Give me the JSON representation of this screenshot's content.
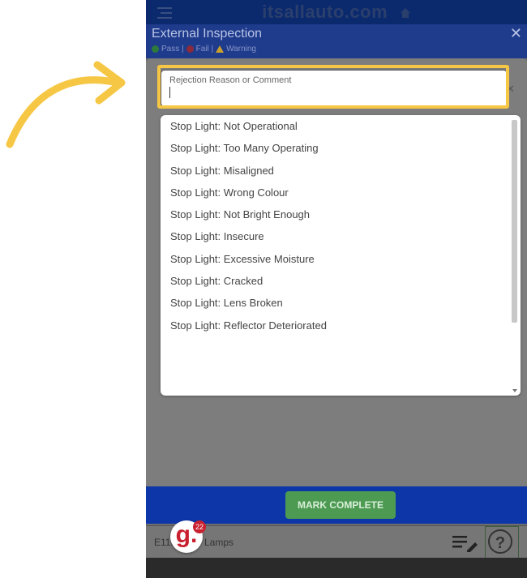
{
  "app": {
    "brand": "itsallauto.com"
  },
  "header": {
    "title": "External Inspection",
    "legend": {
      "pass_label": "Pass |",
      "fail_label": "Fail |",
      "warning_label": "Warning"
    },
    "close_symbol": "✕"
  },
  "search": {
    "label": "Rejection Reason or Comment",
    "value": "",
    "clear_symbol": "✕"
  },
  "reasons": [
    "Stop Light: Not Operational",
    "Stop Light: Too Many Operating",
    "Stop Light: Misaligned",
    "Stop Light: Wrong Colour",
    "Stop Light: Not Bright Enough",
    "Stop Light: Insecure",
    "Stop Light: Excessive Moisture",
    "Stop Light: Cracked",
    "Stop Light: Lens Broken",
    "Stop Light: Reflector Deteriorated"
  ],
  "footer": {
    "mark_complete_label": "MARK COMPLETE"
  },
  "bottom_row": {
    "code": "E11.",
    "label": "Lamps",
    "help_symbol": "?"
  },
  "badge": {
    "letter": "g.",
    "count": "22"
  },
  "colors": {
    "highlight": "#f6c744",
    "header_blue": "#1f3b8c",
    "footer_blue": "#0d36a8",
    "button_green": "#4d9a53"
  },
  "icons": [
    "menu-icon",
    "home-icon",
    "close-icon",
    "list-edit-icon",
    "help-icon",
    "arrow-annotation"
  ]
}
